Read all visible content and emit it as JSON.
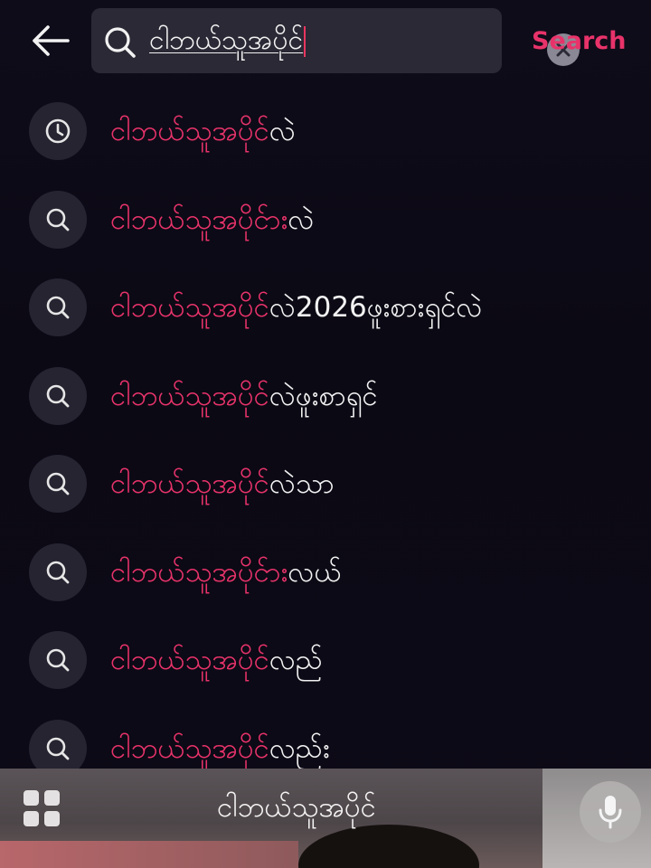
{
  "header": {
    "back_icon": "arrow-left-icon",
    "search_icon": "search-icon",
    "search_value": "ငါဘယ်သူအပိုင်",
    "clear_icon": "close-icon",
    "search_button_label": "Search"
  },
  "colors": {
    "accent": "#e8336a",
    "background": "#0d0a17",
    "search_box": "#2b2935",
    "icon_circle": "#262431",
    "text": "#f2f2f2"
  },
  "suggestions": [
    {
      "icon": "history-clock-icon",
      "match": "ငါဘယ်သူအပိုင်",
      "rest": "လဲ"
    },
    {
      "icon": "search-icon",
      "match": "ငါဘယ်သူအပိုင်",
      "rest": "ားလဲ"
    },
    {
      "icon": "search-icon",
      "match": "ငါဘယ်သူအပိုင်",
      "rest": "လဲ2026ဖူးစားရှင်လဲ"
    },
    {
      "icon": "search-icon",
      "match": "ငါဘယ်သူအပိုင်",
      "rest": "လဲဖူးစာရှင်"
    },
    {
      "icon": "search-icon",
      "match": "ငါဘယ်သူအပိုင်",
      "rest": "လဲသာ"
    },
    {
      "icon": "search-icon",
      "match": "ငါဘယ်သူအပိုင်",
      "rest": "ားလယ်"
    },
    {
      "icon": "search-icon",
      "match": "ငါဘယ်သူအပိုင်",
      "rest": "လည်"
    },
    {
      "icon": "search-icon",
      "match": "ငါဘယ်သူအပိုင်",
      "rest": "လည်း"
    }
  ],
  "bottom_bar": {
    "grid_icon": "grid-icon",
    "text": "ငါဘယ်သူအပိုင်",
    "mic_icon": "microphone-icon"
  }
}
